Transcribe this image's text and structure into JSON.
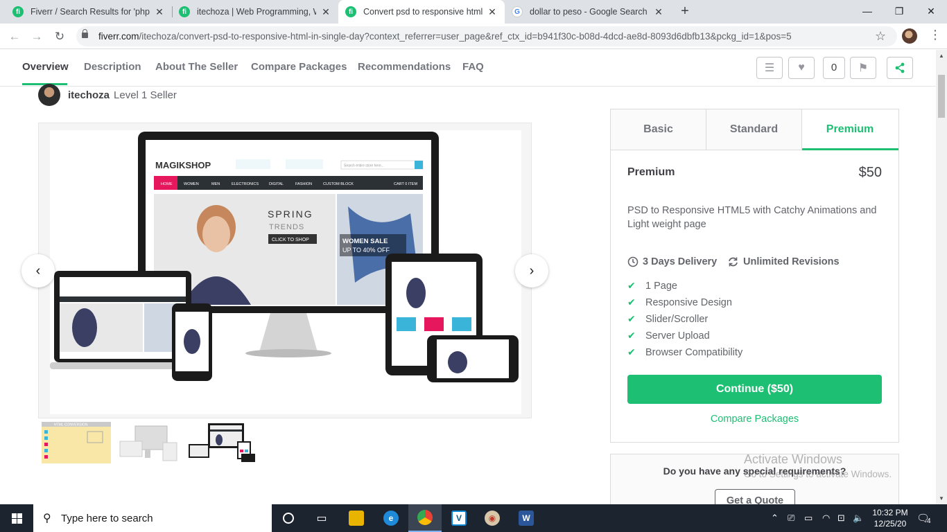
{
  "browser": {
    "tabs": [
      {
        "title": "Fiverr / Search Results for 'php er",
        "favicon": "fiverr"
      },
      {
        "title": "itechoza | Web Programming, Wo",
        "favicon": "fiverr"
      },
      {
        "title": "Convert psd to responsive html b",
        "favicon": "fiverr",
        "active": true
      },
      {
        "title": "dollar to peso - Google Search",
        "favicon": "google"
      }
    ],
    "url_domain": "fiverr.com",
    "url_path": "/itechoza/convert-psd-to-responsive-html-in-single-day?context_referrer=user_page&ref_ctx_id=b941f30c-b08d-4dcd-ae8d-8093d6dbfb13&pckg_id=1&pos=5"
  },
  "subnav": {
    "items": [
      "Overview",
      "Description",
      "About The Seller",
      "Compare Packages",
      "Recommendations",
      "FAQ"
    ],
    "likes_count": "0"
  },
  "seller": {
    "name": "itechoza",
    "level": "Level 1 Seller"
  },
  "gallery": {
    "mock_brand": "MAGIKSHOP",
    "mock_nav": [
      "HOME",
      "WOMEN",
      "MEN",
      "ELECTRONICS",
      "DIGITAL",
      "FASHION",
      "CUSTOM BLOCK"
    ],
    "mock_cart": "CART 0 ITEM",
    "mock_search": "Search entire store here...",
    "mock_spring": "SPRING",
    "mock_trends": "TRENDS",
    "mock_cta": "CLICK TO SHOP",
    "mock_sale": "WOMEN SALE",
    "mock_saleoff": "UP TO 40% OFF",
    "thumb1_label": "HTML CONVERSION"
  },
  "package": {
    "tabs": [
      "Basic",
      "Standard",
      "Premium"
    ],
    "title": "Premium",
    "price": "$50",
    "description": "PSD to Responsive HTML5 with Catchy Animations and Light weight page",
    "delivery": "3 Days Delivery",
    "revisions": "Unlimited Revisions",
    "features": [
      "1 Page",
      "Responsive Design",
      "Slider/Scroller",
      "Server Upload",
      "Browser Compatibility"
    ],
    "continue_label": "Continue ($50)",
    "compare_label": "Compare Packages"
  },
  "requirements": {
    "question": "Do you have any special requirements?",
    "button": "Get a Quote"
  },
  "watermark": {
    "line1": "Activate Windows",
    "line2": "Go to Settings to activate Windows."
  },
  "taskbar": {
    "search_placeholder": "Type here to search",
    "time": "10:32 PM",
    "date": "12/25/20",
    "notifications": "4"
  },
  "colors": {
    "brand": "#1dbf73",
    "accent_pink": "#e6175c",
    "accent_teal": "#3ab5d9"
  }
}
